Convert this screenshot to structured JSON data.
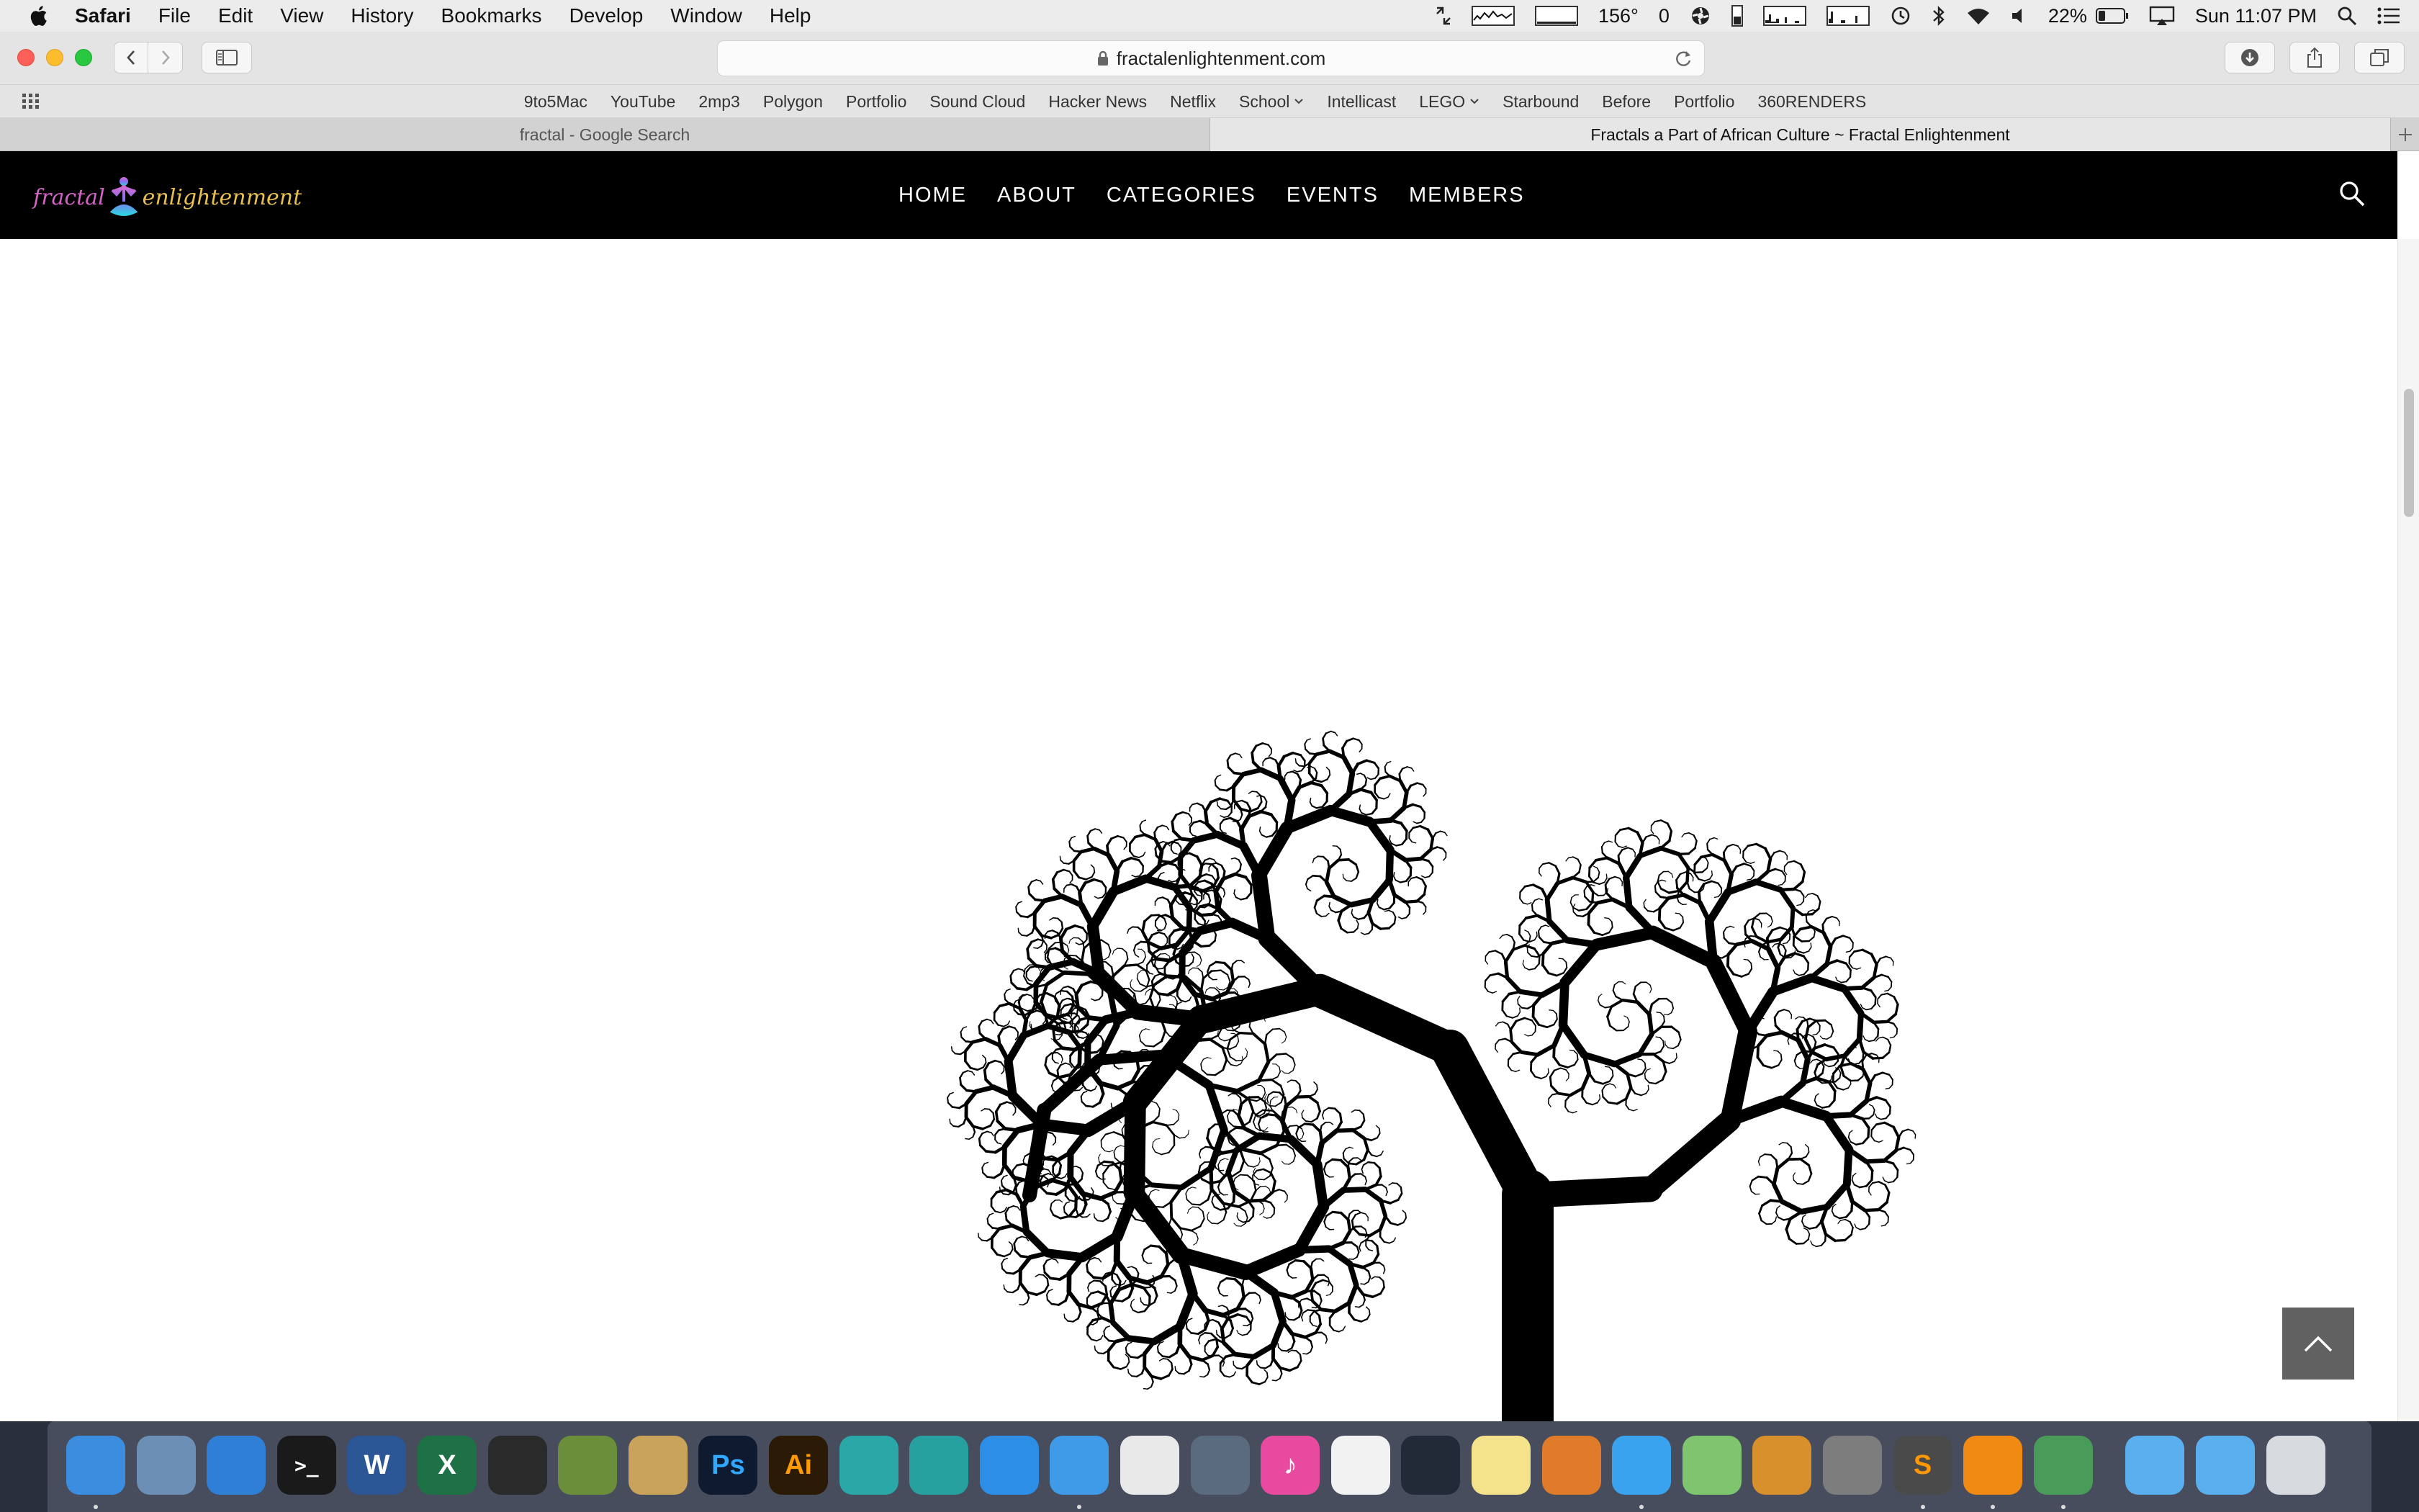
{
  "menubar": {
    "items": [
      "Safari",
      "File",
      "Edit",
      "View",
      "History",
      "Bookmarks",
      "Develop",
      "Window",
      "Help"
    ],
    "status": {
      "temperature": "156°",
      "counter": "0",
      "battery": "22%",
      "clock": "Sun 11:07 PM"
    }
  },
  "browser": {
    "url": "fractalenlightenment.com",
    "bookmarks": [
      "9to5Mac",
      "YouTube",
      "2mp3",
      "Polygon",
      "Portfolio",
      "Sound Cloud",
      "Hacker News",
      "Netflix",
      "School",
      "Intellicast",
      "LEGO",
      "Starbound",
      "Before",
      "Portfolio",
      "360RENDERS"
    ],
    "bookmark_dropdowns": [
      "School",
      "LEGO"
    ],
    "tabs": [
      {
        "title": "fractal - Google Search",
        "active": false
      },
      {
        "title": "Fractals a Part of African Culture ~ Fractal Enlightenment",
        "active": true
      }
    ]
  },
  "site": {
    "logo": {
      "word1": "fractal",
      "word2": "enlightenment"
    },
    "nav": [
      "HOME",
      "ABOUT",
      "CATEGORIES",
      "EVENTS",
      "MEMBERS"
    ]
  },
  "dock": {
    "apps": [
      {
        "name": "finder-icon",
        "glyph": "",
        "color": "#3b8de0",
        "running": true
      },
      {
        "name": "mail-icon",
        "glyph": "",
        "color": "#6c8fb5",
        "running": false
      },
      {
        "name": "xcode-icon",
        "glyph": "",
        "color": "#2f7fd6",
        "running": false
      },
      {
        "name": "terminal-icon",
        "glyph": ">_",
        "color": "#1a1a1a",
        "running": false
      },
      {
        "name": "word-icon",
        "glyph": "W",
        "color": "#2b5797",
        "running": false
      },
      {
        "name": "excel-icon",
        "glyph": "X",
        "color": "#1e7145",
        "running": false
      },
      {
        "name": "unity-icon",
        "glyph": "",
        "color": "#2a2a2a",
        "running": false
      },
      {
        "name": "minecraft-icon",
        "glyph": "",
        "color": "#6b8e3a",
        "running": false
      },
      {
        "name": "pen-tool-icon",
        "glyph": "",
        "color": "#c9a35a",
        "running": false
      },
      {
        "name": "photoshop-icon",
        "glyph": "Ps",
        "color": "#0d1a2f",
        "running": false
      },
      {
        "name": "illustrator-icon",
        "glyph": "Ai",
        "color": "#2b1a06",
        "running": false
      },
      {
        "name": "maya-icon",
        "glyph": "",
        "color": "#2aa7a7",
        "running": false
      },
      {
        "name": "mudbox-icon",
        "glyph": "",
        "color": "#27a0a0",
        "running": false
      },
      {
        "name": "app-store-icon",
        "glyph": "",
        "color": "#2d8ee8",
        "running": false
      },
      {
        "name": "safari-icon",
        "glyph": "",
        "color": "#3f9ae8",
        "running": true
      },
      {
        "name": "chrome-icon",
        "glyph": "",
        "color": "#e9e9e9",
        "running": false
      },
      {
        "name": "dvd-player-icon",
        "glyph": "",
        "color": "#5a6b80",
        "running": false
      },
      {
        "name": "itunes-icon",
        "glyph": "♪",
        "color": "#e84a9f",
        "running": false
      },
      {
        "name": "photos-icon",
        "glyph": "",
        "color": "#f2f2f2",
        "running": false
      },
      {
        "name": "speed-gauge-icon",
        "glyph": "",
        "color": "#222a38",
        "running": false
      },
      {
        "name": "notes-icon",
        "glyph": "",
        "color": "#f4e38a",
        "running": false
      },
      {
        "name": "maze-game-icon",
        "glyph": "",
        "color": "#e07b2a",
        "running": false
      },
      {
        "name": "messages-icon",
        "glyph": "",
        "color": "#3aa3f0",
        "running": true
      },
      {
        "name": "maps-icon",
        "glyph": "",
        "color": "#7fc46f",
        "running": false
      },
      {
        "name": "flight-game-icon",
        "glyph": "",
        "color": "#d8902c",
        "running": false
      },
      {
        "name": "system-preferences-icon",
        "glyph": "",
        "color": "#7d7d7d",
        "running": false
      },
      {
        "name": "sublime-text-icon",
        "glyph": "S",
        "color": "#4a4a4a",
        "running": true
      },
      {
        "name": "vlc-icon",
        "glyph": "",
        "color": "#f08a12",
        "running": true
      },
      {
        "name": "network-globe-icon",
        "glyph": "",
        "color": "#4a9a5a",
        "running": true
      },
      {
        "name": "applications-folder-icon",
        "glyph": "",
        "color": "#5ab0ee",
        "running": false
      },
      {
        "name": "downloads-folder-icon",
        "glyph": "",
        "color": "#5ab0ee",
        "running": false
      },
      {
        "name": "trash-icon",
        "glyph": "",
        "color": "#d7dbe0",
        "running": false
      }
    ]
  }
}
